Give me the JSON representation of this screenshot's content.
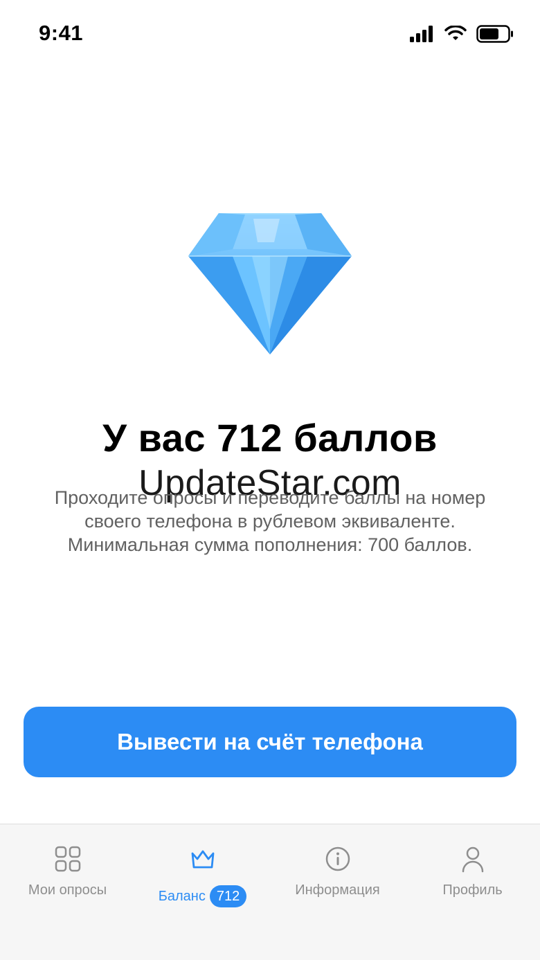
{
  "status_bar": {
    "time": "9:41"
  },
  "balance": {
    "title": "У вас 712 баллов",
    "watermark": "UpdateStar.com",
    "description_lines": [
      "Проходите опросы и переводите баллы на номер",
      "своего телефона в рублевом эквиваленте.",
      "Минимальная сумма пополнения: 700 баллов."
    ]
  },
  "withdraw_button": {
    "label": "Вывести на счёт телефона"
  },
  "tab_bar": {
    "tabs": [
      {
        "label": "Мои опросы",
        "icon": "grid-icon"
      },
      {
        "label": "Баланс",
        "icon": "crown-icon",
        "badge": "712",
        "active": true
      },
      {
        "label": "Информация",
        "icon": "info-icon"
      },
      {
        "label": "Профиль",
        "icon": "user-icon"
      }
    ]
  },
  "colors": {
    "accent": "#2c8cf4",
    "muted": "#8e8e8e",
    "tab_bg": "#f6f6f6"
  }
}
